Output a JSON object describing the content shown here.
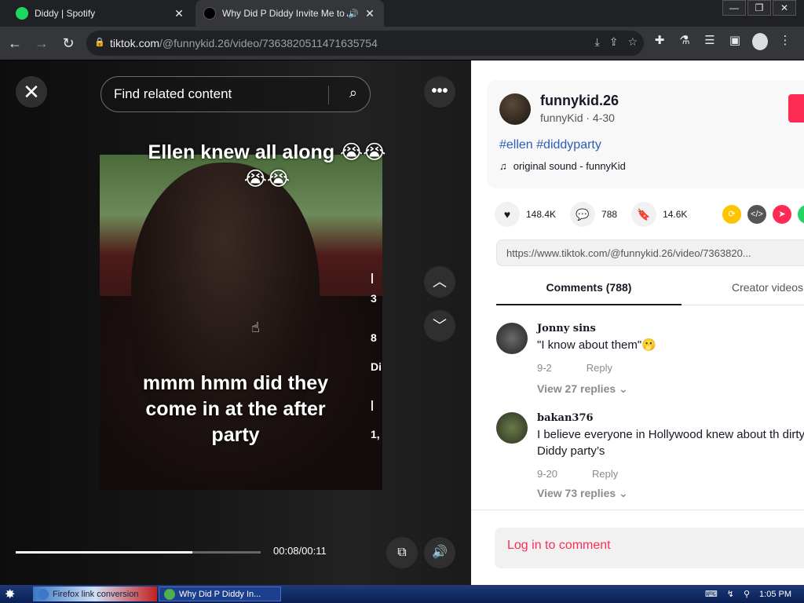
{
  "browser": {
    "tabs": [
      {
        "title": "Diddy | Spotify",
        "favicon_color": "#1ed760",
        "active": false
      },
      {
        "title": "Why Did P Diddy Invite Me to A",
        "favicon_color": "#000000",
        "active": true
      }
    ],
    "url_host": "tiktok.com",
    "url_path": "/@funnykid.26/video/7363820511471635754"
  },
  "video": {
    "search_placeholder": "Find related content",
    "caption_top": "Ellen knew all along 😭😭 😭😭",
    "caption_mid": "mmm hmm did they come in at the after party",
    "time": "00:08/00:11",
    "progress": 0.72
  },
  "author": {
    "name": "funnykid.26",
    "sub": "funnyKid · 4-30",
    "hashtags": "#ellen #diddyparty",
    "sound": "original sound - funnyKid"
  },
  "stats": {
    "likes": "148.4K",
    "comments": "788",
    "saves": "14.6K"
  },
  "link": "https://www.tiktok.com/@funnykid.26/video/7363820...",
  "tabs": {
    "comments": "Comments (788)",
    "creator": "Creator videos"
  },
  "comments": [
    {
      "user": "Jonny sins",
      "text": "\"I know about them\"🫢",
      "date": "9-2",
      "reply": "Reply",
      "view": "View 27 replies ⌄"
    },
    {
      "user": "bakan376",
      "text": "I believe everyone in Hollywood knew about th dirty Diddy party’s",
      "date": "9-20",
      "reply": "Reply",
      "view": "View 73 replies ⌄"
    }
  ],
  "login_label": "Log in to comment",
  "taskbar": {
    "item1": "Firefox link conversion",
    "item2": "Why Did P Diddy In...",
    "clock": "1:05 PM"
  }
}
